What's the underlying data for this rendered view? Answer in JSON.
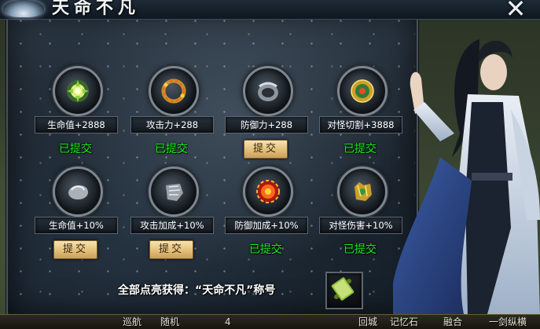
{
  "window": {
    "title": "天命不凡",
    "close_symbol": "✕"
  },
  "slots_row1": [
    {
      "icon": "flower-orb-icon",
      "attr": "生命值+2888",
      "status": "已提交",
      "submitted": true
    },
    {
      "icon": "flame-ring-icon",
      "attr": "攻击力+288",
      "status": "已提交",
      "submitted": true
    },
    {
      "icon": "silver-ring-icon",
      "attr": "防御力+288",
      "button": "提交",
      "submitted": false
    },
    {
      "icon": "jade-amulet-icon",
      "attr": "对怪切割+3888",
      "status": "已提交",
      "submitted": true
    }
  ],
  "slots_row2": [
    {
      "icon": "silver-stone-icon",
      "attr": "生命值+10%",
      "button": "提交",
      "submitted": false
    },
    {
      "icon": "steel-gauntlet-icon",
      "attr": "攻击加成+10%",
      "button": "提交",
      "submitted": false
    },
    {
      "icon": "fire-seal-icon",
      "attr": "防御加成+10%",
      "status": "已提交",
      "submitted": true
    },
    {
      "icon": "golden-glove-icon",
      "attr": "对怪伤害+10%",
      "status": "已提交",
      "submitted": true
    }
  ],
  "reward": {
    "text": "全部点亮获得：“天命不凡”称号",
    "icon": "scroll-title-icon"
  },
  "bottom_bar": {
    "items": [
      "巡航",
      "随机",
      "4",
      "回城",
      "记忆石",
      "融合",
      "一剑纵横"
    ]
  },
  "colors": {
    "submitted_green": "#18f018",
    "button_gold": "#e2bf7a",
    "label_bg": "#12171d"
  }
}
